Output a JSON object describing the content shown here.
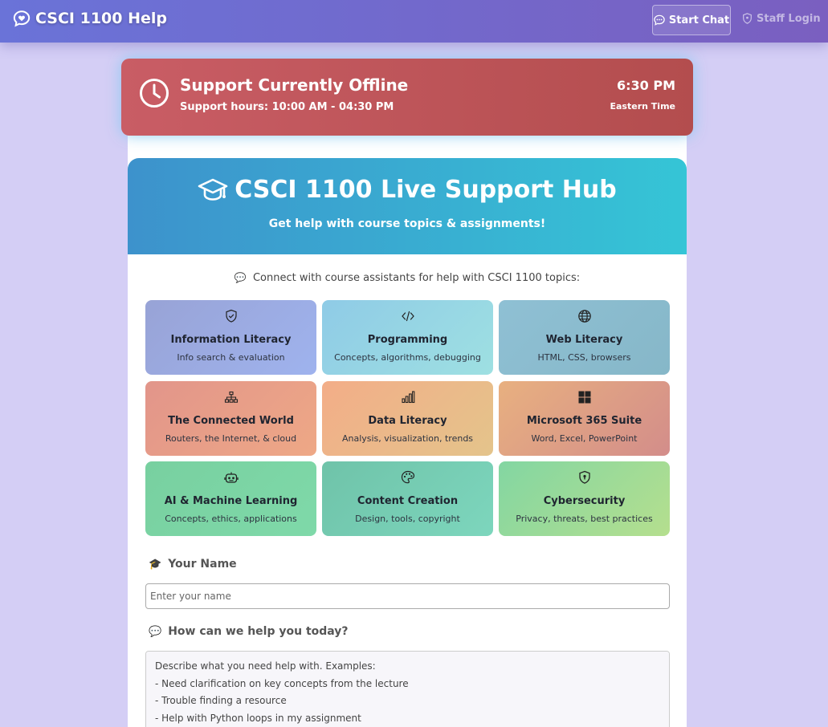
{
  "nav": {
    "brand": "CSCI 1100 Help",
    "start_chat": "Start Chat",
    "staff_login": "Staff Login"
  },
  "status": {
    "title": "Support Currently Offline",
    "hours": "Support hours: 10:00 AM - 04:30 PM",
    "time": "6:30 PM",
    "timezone": "Eastern Time"
  },
  "hero": {
    "title": "CSCI 1100 Live Support Hub",
    "subtitle": "Get help with course topics & assignments!"
  },
  "intro": "Connect with course assistants for help with CSCI 1100 topics:",
  "topics": [
    {
      "name": "Information Literacy",
      "desc": "Info search & evaluation",
      "icon": "shield-check-icon"
    },
    {
      "name": "Programming",
      "desc": "Concepts, algorithms, debugging",
      "icon": "code-icon"
    },
    {
      "name": "Web Literacy",
      "desc": "HTML, CSS, browsers",
      "icon": "globe-icon"
    },
    {
      "name": "The Connected World",
      "desc": "Routers, the Internet, & cloud",
      "icon": "network-icon"
    },
    {
      "name": "Data Literacy",
      "desc": "Analysis, visualization, trends",
      "icon": "bar-chart-icon"
    },
    {
      "name": "Microsoft 365 Suite",
      "desc": "Word, Excel, PowerPoint",
      "icon": "windows-icon"
    },
    {
      "name": "AI & Machine Learning",
      "desc": "Concepts, ethics, applications",
      "icon": "robot-icon"
    },
    {
      "name": "Content Creation",
      "desc": "Design, tools, copyright",
      "icon": "palette-icon"
    },
    {
      "name": "Cybersecurity",
      "desc": "Privacy, threats, best practices",
      "icon": "shield-lock-icon"
    }
  ],
  "form": {
    "name_label": "Your Name",
    "name_placeholder": "Enter your name",
    "help_label": "How can we help you today?",
    "help_placeholder": "Describe what you need help with. Examples:\n- Need clarification on key concepts from the lecture\n- Trouble finding a resource\n- Help with Python loops in my assignment"
  },
  "colors": {
    "nav_start": "#6a73d8",
    "nav_end": "#7a5fc0",
    "offline_banner": "#c05558",
    "hero_start": "#3d92cc",
    "hero_end": "#35c5d6",
    "page_background": "#d4cef5"
  }
}
